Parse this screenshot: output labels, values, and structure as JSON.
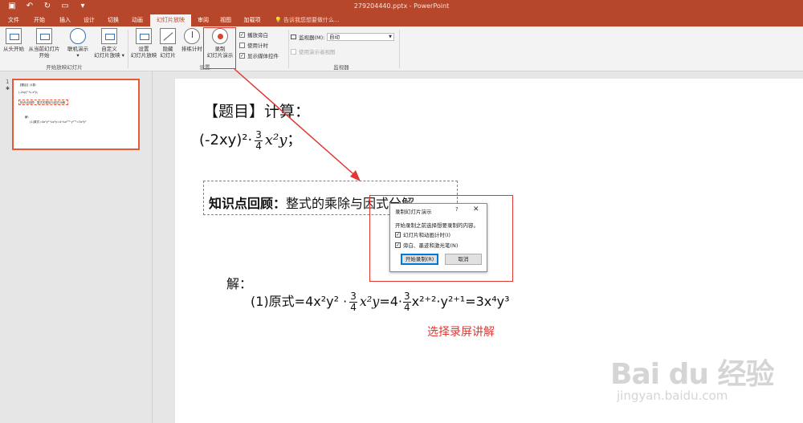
{
  "window": {
    "title": "279204440.pptx - PowerPoint"
  },
  "quick_access": {
    "save_icon": "save-icon",
    "undo_icon": "undo-icon",
    "redo_icon": "redo-icon",
    "start_icon": "start-from-beginning-icon",
    "customize_icon": "customize-qat-icon"
  },
  "tabs": [
    "文件",
    "开始",
    "插入",
    "设计",
    "切换",
    "动画",
    "幻灯片放映",
    "审阅",
    "视图",
    "加载项"
  ],
  "active_tab": "幻灯片放映",
  "tell_me": "告诉我您想要做什么...",
  "ribbon": {
    "start_group": {
      "label": "开始放映幻灯片",
      "from_beginning": "从头开始",
      "from_current_1": "从当前幻灯片",
      "from_current_2": "开始",
      "online_1": "联机演示",
      "online_2": "▾",
      "custom_1": "自定义",
      "custom_2": "幻灯片放映 ▾"
    },
    "setup_group": {
      "label": "设置",
      "setup_show_1": "设置",
      "setup_show_2": "幻灯片放映",
      "hide_slide_1": "隐藏",
      "hide_slide_2": "幻灯片",
      "rehearse": "排练计时",
      "record_1": "录制",
      "record_2": "幻灯片演示",
      "play_narrations": "播放旁白",
      "use_timings": "使用计时",
      "show_media_controls": "显示媒体控件"
    },
    "monitor_group": {
      "label": "监视器",
      "monitor_label": "监视器(M):",
      "monitor_value": "自动",
      "presenter_view": "使用演示者视图"
    }
  },
  "thumbnail": {
    "number": "1",
    "star": "✱",
    "line1": "【题目】计算：",
    "line2": "(-2xy)²·¾ x²y；",
    "line3": "知识点回顾：整式的乘除与因式分解",
    "line4": "解：",
    "line5": "(1)原式=4x²y²·¾x²y=4·¾x²⁺²·y²⁺¹=3x⁴y³"
  },
  "slide": {
    "title": "【题目】计算：",
    "expr_prefix": "(-2xy)²·",
    "frac_num": "3",
    "frac_den": "4",
    "expr_var": "x²y",
    "expr_suffix": "；",
    "review_bold": "知识点回顾：",
    "review_text": "整式的乘除与因式分解",
    "solution_label": "解：",
    "sol_a": "(1)原式=4x²y² ·",
    "sol_var": "x²y",
    "sol_b": "=4·",
    "sol_c": "x²⁺²·y²⁺¹=3x⁴y³",
    "caption": "选择录屏讲解"
  },
  "dialog": {
    "title": "录制幻灯片演示",
    "help": "?",
    "close": "✕",
    "message": "开始录制之前选择想要录制的内容。",
    "option1": "幻灯片和动画计时(I)",
    "option2": "旁白、墨迹和激光笔(N)",
    "start_button": "开始录制(R)",
    "cancel_button": "取消"
  },
  "watermark": {
    "big": "Bai du 经验",
    "small": "jingyan.baidu.com"
  },
  "colors": {
    "accent": "#b7472a",
    "highlight_red": "#e0372f",
    "dashed_orange": "#e8593a"
  }
}
